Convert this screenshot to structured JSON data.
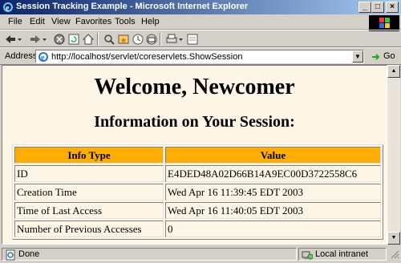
{
  "window": {
    "title": "Session Tracking Example - Microsoft Internet Explorer"
  },
  "menu": {
    "items": [
      "File",
      "Edit",
      "View",
      "Favorites",
      "Tools",
      "Help"
    ]
  },
  "address": {
    "label": "Address",
    "url": "http://localhost/servlet/coreservlets.ShowSession",
    "go_label": "Go"
  },
  "page": {
    "heading": "Welcome, Newcomer",
    "subheading": "Information on Your Session:",
    "table": {
      "headers": [
        "Info Type",
        "Value"
      ],
      "rows": [
        [
          "ID",
          "E4DED48A02D66B14A9EC00D3722558C6"
        ],
        [
          "Creation Time",
          "Wed Apr 16 11:39:45 EDT 2003"
        ],
        [
          "Time of Last Access",
          "Wed Apr 16 11:40:05 EDT 2003"
        ],
        [
          "Number of Previous Accesses",
          "0"
        ]
      ],
      "header_color": "#ffad00"
    },
    "background_color": "#fdf5e6"
  },
  "status": {
    "text": "Done",
    "zone": "Local intranet"
  },
  "icons": [
    "ie-icon",
    "back-icon",
    "forward-icon",
    "stop-icon",
    "refresh-icon",
    "home-icon",
    "search-icon",
    "favorites-icon",
    "history-icon",
    "mail-icon",
    "print-icon",
    "edit-icon",
    "go-icon",
    "minimize-icon",
    "maximize-icon",
    "close-icon",
    "windows-logo-icon"
  ]
}
